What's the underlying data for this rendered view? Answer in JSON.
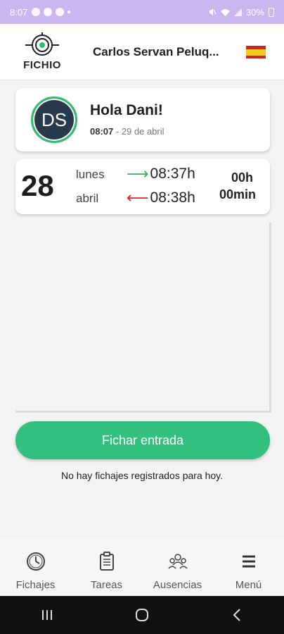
{
  "status_bar": {
    "time": "8:07",
    "battery": "30%"
  },
  "header": {
    "logo_text": "FICHIO",
    "company": "Carlos Servan Peluq...",
    "flag_icon": "spain-flag-icon"
  },
  "greeting": {
    "initials": "DS",
    "title": "Hola Dani!",
    "time": "08:07",
    "separator": " - ",
    "date": "29 de abril"
  },
  "day": {
    "number": "28",
    "weekday": "lunes",
    "month": "abril",
    "time_in": "08:37h",
    "time_out": "08:38h",
    "duration_hours": "00h",
    "duration_minutes": "00min"
  },
  "action": {
    "button_label": "Fichar entrada",
    "empty_message": "No hay fichajes registrados para hoy."
  },
  "nav": {
    "items": [
      {
        "label": "Fichajes",
        "icon": "clock-icon"
      },
      {
        "label": "Tareas",
        "icon": "clipboard-icon"
      },
      {
        "label": "Ausencias",
        "icon": "people-icon"
      },
      {
        "label": "Menú",
        "icon": "menu-icon"
      }
    ]
  },
  "colors": {
    "accent": "#33c07f",
    "status_bar": "#c9b6f0",
    "avatar_ring": "#2fbf6e",
    "arrow_in": "#2eb84f",
    "arrow_out": "#e0231f"
  }
}
